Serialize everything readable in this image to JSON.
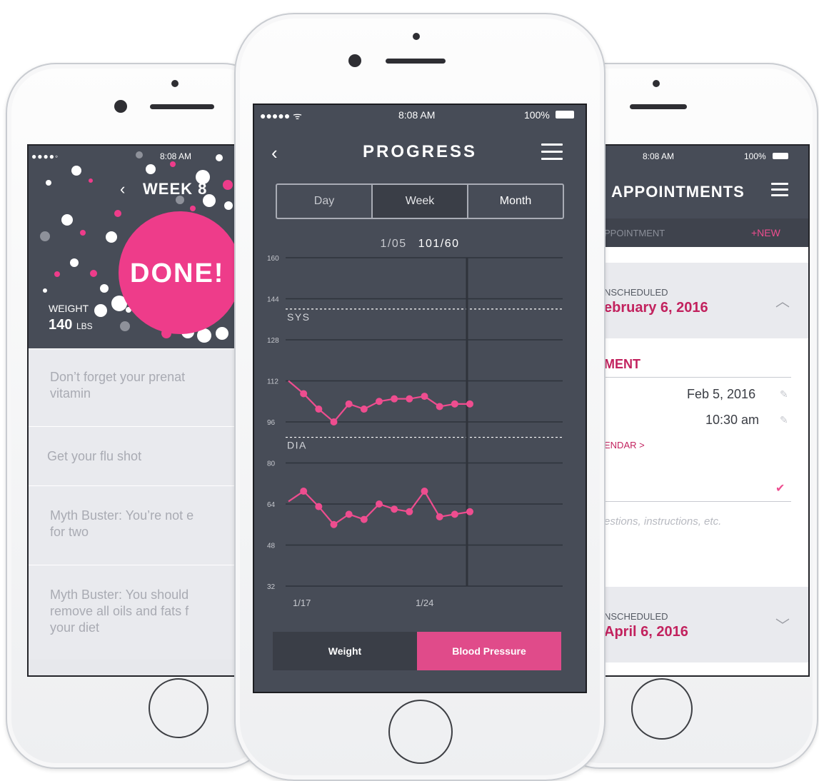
{
  "left_phone": {
    "status": {
      "signal": "●●●●◦",
      "time": "8:08 AM"
    },
    "header": {
      "back_icon": "chevron-left-icon",
      "title": "WEEK 8"
    },
    "hero": {
      "done_label": "DONE!",
      "weight_label": "WEIGHT",
      "weight_value": "140",
      "weight_unit": "LBS"
    },
    "tips": [
      {
        "line1": "Don’t forget your prenat",
        "line2": "vitamin"
      },
      {
        "line1": "Get your flu shot",
        "line2": ""
      },
      {
        "line1": "Myth Buster: You’re not e",
        "line2": "for two"
      },
      {
        "line1": "Myth Buster: You should",
        "line2": "remove all oils and fats f",
        "line3": "your diet"
      }
    ]
  },
  "center_phone": {
    "status": {
      "signal": "●●●●● ᯤ",
      "time": "8:08 AM",
      "battery": "100%"
    },
    "header": {
      "back_icon": "chevron-left-icon",
      "title": "PROGRESS",
      "menu_icon": "hamburger-menu-icon"
    },
    "range_tabs": [
      {
        "label": "Day",
        "selected": false
      },
      {
        "label": "Week",
        "selected": true
      },
      {
        "label": "Month",
        "selected": false
      }
    ],
    "readout": {
      "date": "1/05",
      "value": "101/60"
    },
    "metric_tabs": [
      {
        "label": "Weight",
        "selected": false
      },
      {
        "label": "Blood Pressure",
        "selected": true
      }
    ],
    "colors": {
      "background": "#474c57",
      "accent": "#e04b8a",
      "line": "#ee4d8f"
    }
  },
  "right_phone": {
    "status": {
      "time": "8:08 AM",
      "battery": "100%"
    },
    "header": {
      "title": "APPOINTMENTS",
      "menu_icon": "hamburger-menu-icon"
    },
    "subheader": {
      "label": "PPOINTMENT",
      "new_label": "+NEW"
    },
    "cards": [
      {
        "status": "NSCHEDULED",
        "date": "ebruary 6, 2016",
        "chevron": "chevron-up-icon"
      },
      {
        "status": "NSCHEDULED",
        "date": "April 6, 2016",
        "chevron": "chevron-down-icon"
      }
    ],
    "form": {
      "section_title": "MENT",
      "date_value": "Feb 5, 2016",
      "time_value": "10:30 am",
      "calendar_link": "ENDAR >",
      "notes_placeholder": "estions, instructions, etc."
    }
  },
  "chart_data": {
    "type": "line",
    "title": "",
    "xlabel": "",
    "ylabel": "",
    "ylim": [
      32,
      160
    ],
    "y_ticks": [
      160,
      144,
      128,
      112,
      96,
      80,
      64,
      48,
      32
    ],
    "x_tick_labels": [
      "1/17",
      "1/24"
    ],
    "threshold_lines": [
      {
        "label": "SYS",
        "value": 140
      },
      {
        "label": "DIA",
        "value": 90
      }
    ],
    "grid": true,
    "series": [
      {
        "values": [
          112,
          107,
          101,
          96,
          103,
          101,
          104,
          105,
          105,
          106,
          102,
          103,
          103
        ]
      },
      {
        "values": [
          65,
          69,
          63,
          56,
          60,
          58,
          64,
          62,
          61,
          69,
          59,
          60,
          61
        ]
      }
    ]
  }
}
